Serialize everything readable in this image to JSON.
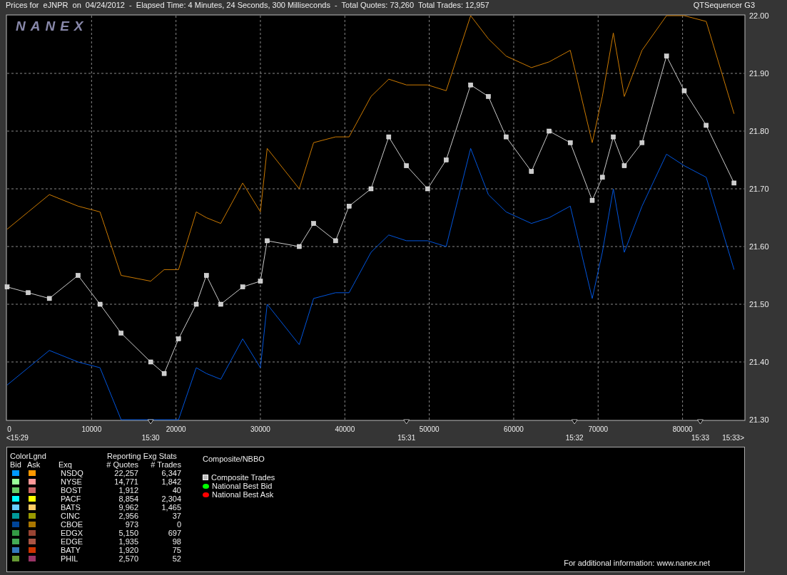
{
  "header": {
    "title": "Prices for  eJNPR  on  04/24/2012  -  Elapsed Time: 4 Minutes, 24 Seconds, 300 Milliseconds  -  Total Quotes: 73,260  Total Trades: 12,957",
    "app": "QTSequencer G3"
  },
  "chart": {
    "logo": "NANEX",
    "time_labels": [
      "<15:29",
      "15:30",
      "15:31",
      "15:32",
      "15:33",
      "15:33>"
    ],
    "chart_data": {
      "type": "line",
      "grid": true,
      "xlim": [
        0,
        87300
      ],
      "ylim": [
        21.3,
        22.0
      ],
      "xticks": [
        0,
        10000,
        20000,
        30000,
        40000,
        50000,
        60000,
        70000,
        80000
      ],
      "yticks": [
        {
          "value": 21.3,
          "label": "21.30"
        },
        {
          "value": 21.4,
          "label": "21.40"
        },
        {
          "value": 21.5,
          "label": "21.50"
        },
        {
          "value": 21.6,
          "label": "21.60"
        },
        {
          "value": 21.7,
          "label": "21.70"
        },
        {
          "value": 21.8,
          "label": "21.80"
        },
        {
          "value": 21.9,
          "label": "21.90"
        },
        {
          "value": 22.0,
          "label": "22.00"
        }
      ],
      "x": [
        0,
        2500,
        5000,
        8400,
        11000,
        13500,
        17000,
        18600,
        20300,
        22400,
        23600,
        25300,
        27900,
        30000,
        30800,
        34600,
        36300,
        38900,
        40500,
        43100,
        45200,
        47300,
        49800,
        52000,
        54900,
        57000,
        59100,
        62100,
        64200,
        66700,
        69300,
        70500,
        71800,
        73100,
        75200,
        78100,
        80200,
        82800,
        86100
      ],
      "series": [
        {
          "color": "#cc7a00",
          "values": [
            21.63,
            21.66,
            21.69,
            21.67,
            21.66,
            21.55,
            21.54,
            21.56,
            21.56,
            21.66,
            21.65,
            21.64,
            21.71,
            21.66,
            21.77,
            21.7,
            21.78,
            21.79,
            21.79,
            21.86,
            21.89,
            21.88,
            21.88,
            21.87,
            22.0,
            21.96,
            21.93,
            21.91,
            21.92,
            21.94,
            21.78,
            21.86,
            21.97,
            21.86,
            21.94,
            22.0,
            22.0,
            21.99,
            21.83
          ]
        },
        {
          "color": "#0055dd",
          "values": [
            21.36,
            21.39,
            21.42,
            21.4,
            21.39,
            21.3,
            21.3,
            21.3,
            21.3,
            21.39,
            21.38,
            21.37,
            21.44,
            21.39,
            21.5,
            21.43,
            21.51,
            21.52,
            21.52,
            21.59,
            21.62,
            21.61,
            21.61,
            21.6,
            21.77,
            21.69,
            21.66,
            21.64,
            21.65,
            21.67,
            21.51,
            21.59,
            21.7,
            21.59,
            21.67,
            21.76,
            21.74,
            21.72,
            21.56
          ]
        },
        {
          "color": "#cccccc",
          "marker": "square",
          "values": [
            21.53,
            21.52,
            21.51,
            21.55,
            21.5,
            21.45,
            21.4,
            21.38,
            21.44,
            21.5,
            21.55,
            21.5,
            21.53,
            21.54,
            21.61,
            21.6,
            21.64,
            21.61,
            21.67,
            21.7,
            21.79,
            21.74,
            21.7,
            21.75,
            21.88,
            21.86,
            21.79,
            21.73,
            21.8,
            21.78,
            21.68,
            21.72,
            21.79,
            21.74,
            21.78,
            21.93,
            21.87,
            21.81,
            21.71
          ]
        }
      ]
    }
  },
  "legend": {
    "title": "ColorLgnd",
    "bid_label": "Bid",
    "ask_label": "Ask",
    "stats_title": "Reporting Exg Stats",
    "columns": [
      "Exq",
      "# Quotes",
      "# Trades"
    ],
    "exchanges": [
      {
        "name": "NSDQ",
        "bid": {
          "color": "#0099ff"
        },
        "ask": {
          "color": "#ff9900"
        },
        "quotes": "22,257",
        "trades": "6,347"
      },
      {
        "name": "NYSE",
        "bid": {
          "color": "#99ff99"
        },
        "ask": {
          "color": "#ff9999"
        },
        "quotes": "14,771",
        "trades": "1,842"
      },
      {
        "name": "BOST",
        "bid": {
          "color": "#66cc66"
        },
        "ask": {
          "color": "#cc6666"
        },
        "quotes": "1,912",
        "trades": "40"
      },
      {
        "name": "PACF",
        "bid": {
          "color": "#00ffff"
        },
        "ask": {
          "color": "#ffff00"
        },
        "quotes": "8,854",
        "trades": "2,304"
      },
      {
        "name": "BATS",
        "bid": {
          "color": "#66ccff"
        },
        "ask": {
          "color": "#ffcc66"
        },
        "quotes": "9,962",
        "trades": "1,465"
      },
      {
        "name": "CINC",
        "bid": {
          "color": "#009999"
        },
        "ask": {
          "color": "#999900"
        },
        "quotes": "2,956",
        "trades": "37"
      },
      {
        "name": "CBOE",
        "bid": {
          "color": "#004499"
        },
        "ask": {
          "color": "#aa7700"
        },
        "quotes": "973",
        "trades": "0"
      },
      {
        "name": "EDGX",
        "bid": {
          "color": "#339944"
        },
        "ask": {
          "color": "#994433"
        },
        "quotes": "5,150",
        "trades": "697"
      },
      {
        "name": "EDGE",
        "bid": {
          "color": "#44aa55"
        },
        "ask": {
          "color": "#aa5544"
        },
        "quotes": "1,935",
        "trades": "98"
      },
      {
        "name": "BATY",
        "bid": {
          "color": "#3377bb"
        },
        "ask": {
          "color": "#cc3300"
        },
        "quotes": "1,920",
        "trades": "75"
      },
      {
        "name": "PHIL",
        "bid": {
          "color": "#669933"
        },
        "ask": {
          "color": "#993366"
        },
        "quotes": "2,570",
        "trades": "52"
      }
    ],
    "nbbo_title": "Composite/NBBO",
    "nbbo": [
      {
        "kind": "square",
        "label": "Composite Trades",
        "color": "#bbbbbb"
      },
      {
        "kind": "dot",
        "label": "National Best Bid",
        "color": "#00ff00"
      },
      {
        "kind": "dot",
        "label": "National Best Ask",
        "color": "#ff0000"
      }
    ],
    "footer": "For additional information: www.nanex.net"
  }
}
